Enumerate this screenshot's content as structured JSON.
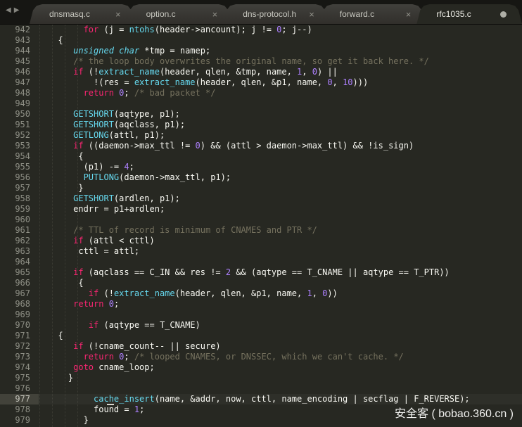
{
  "colors": {
    "background": "#272822",
    "tab_bar": "#161613",
    "tab_inactive_top": "#41403c",
    "tab_inactive_bottom": "#312f2b",
    "text": "#f8f8f2",
    "keyword": "#f92672",
    "function": "#66d9ef",
    "type": "#66d9ef",
    "number": "#ae81ff",
    "comment": "#75715e",
    "line_number": "#8f9086",
    "current_line_gutter": "#42423a"
  },
  "tab_bar": {
    "nav": {
      "back_label": "◀",
      "forward_label": "▶"
    },
    "tabs": [
      {
        "label": "dnsmasq.c",
        "close": "×",
        "active": false,
        "modified": false
      },
      {
        "label": "option.c",
        "close": "×",
        "active": false,
        "modified": false
      },
      {
        "label": "dns-protocol.h",
        "close": "×",
        "active": false,
        "modified": false
      },
      {
        "label": "forward.c",
        "close": "×",
        "active": false,
        "modified": false
      },
      {
        "label": "rfc1035.c",
        "close": "",
        "active": true,
        "modified": true
      }
    ]
  },
  "editor": {
    "language": "C",
    "current_line": 977,
    "lines": [
      {
        "n": 942,
        "indent": 7,
        "tokens": [
          [
            "k",
            "for"
          ],
          [
            "p",
            " (j = "
          ],
          [
            "f",
            "ntohs"
          ],
          [
            "p",
            "(header->ancount); j != "
          ],
          [
            "n",
            "0"
          ],
          [
            "p",
            "; j--)"
          ]
        ]
      },
      {
        "n": 943,
        "indent": 2,
        "tokens": [
          [
            "p",
            "{"
          ]
        ]
      },
      {
        "n": 944,
        "indent": 5,
        "tokens": [
          [
            "y",
            "unsigned"
          ],
          [
            "p",
            " "
          ],
          [
            "y",
            "char"
          ],
          [
            "p",
            " *tmp = namep;"
          ]
        ]
      },
      {
        "n": 945,
        "indent": 5,
        "tokens": [
          [
            "c",
            "/* the loop body overwrites the original name, so get it back here. */"
          ]
        ]
      },
      {
        "n": 946,
        "indent": 5,
        "tokens": [
          [
            "k",
            "if"
          ],
          [
            "p",
            " (!"
          ],
          [
            "f",
            "extract_name"
          ],
          [
            "p",
            "(header, qlen, &tmp, name, "
          ],
          [
            "n",
            "1"
          ],
          [
            "p",
            ", "
          ],
          [
            "n",
            "0"
          ],
          [
            "p",
            ") ||"
          ]
        ]
      },
      {
        "n": 947,
        "indent": 9,
        "tokens": [
          [
            "p",
            "!(res = "
          ],
          [
            "f",
            "extract_name"
          ],
          [
            "p",
            "(header, qlen, &p1, name, "
          ],
          [
            "n",
            "0"
          ],
          [
            "p",
            ", "
          ],
          [
            "n",
            "10"
          ],
          [
            "p",
            ")))"
          ]
        ]
      },
      {
        "n": 948,
        "indent": 7,
        "tokens": [
          [
            "k",
            "return"
          ],
          [
            "p",
            " "
          ],
          [
            "n",
            "0"
          ],
          [
            "p",
            "; "
          ],
          [
            "c",
            "/* bad packet */"
          ]
        ]
      },
      {
        "n": 949,
        "indent": 0,
        "tokens": []
      },
      {
        "n": 950,
        "indent": 5,
        "tokens": [
          [
            "f",
            "GETSHORT"
          ],
          [
            "p",
            "(aqtype, p1);"
          ]
        ]
      },
      {
        "n": 951,
        "indent": 5,
        "tokens": [
          [
            "f",
            "GETSHORT"
          ],
          [
            "p",
            "(aqclass, p1);"
          ]
        ]
      },
      {
        "n": 952,
        "indent": 5,
        "tokens": [
          [
            "f",
            "GETLONG"
          ],
          [
            "p",
            "(attl, p1);"
          ]
        ]
      },
      {
        "n": 953,
        "indent": 5,
        "tokens": [
          [
            "k",
            "if"
          ],
          [
            "p",
            " ((daemon->max_ttl != "
          ],
          [
            "n",
            "0"
          ],
          [
            "p",
            ") && (attl > daemon->max_ttl) && !is_sign)"
          ]
        ]
      },
      {
        "n": 954,
        "indent": 6,
        "tokens": [
          [
            "p",
            "{"
          ]
        ]
      },
      {
        "n": 955,
        "indent": 7,
        "tokens": [
          [
            "p",
            "(p1) -= "
          ],
          [
            "n",
            "4"
          ],
          [
            "p",
            ";"
          ]
        ]
      },
      {
        "n": 956,
        "indent": 7,
        "tokens": [
          [
            "f",
            "PUTLONG"
          ],
          [
            "p",
            "(daemon->max_ttl, p1);"
          ]
        ]
      },
      {
        "n": 957,
        "indent": 6,
        "tokens": [
          [
            "p",
            "}"
          ]
        ]
      },
      {
        "n": 958,
        "indent": 5,
        "tokens": [
          [
            "f",
            "GETSHORT"
          ],
          [
            "p",
            "(ardlen, p1);"
          ]
        ]
      },
      {
        "n": 959,
        "indent": 5,
        "tokens": [
          [
            "p",
            "endrr = p1+ardlen;"
          ]
        ]
      },
      {
        "n": 960,
        "indent": 0,
        "tokens": []
      },
      {
        "n": 961,
        "indent": 5,
        "tokens": [
          [
            "c",
            "/* TTL of record is minimum of CNAMES and PTR */"
          ]
        ]
      },
      {
        "n": 962,
        "indent": 5,
        "tokens": [
          [
            "k",
            "if"
          ],
          [
            "p",
            " (attl < cttl)"
          ]
        ]
      },
      {
        "n": 963,
        "indent": 6,
        "tokens": [
          [
            "p",
            "cttl = attl;"
          ]
        ]
      },
      {
        "n": 964,
        "indent": 0,
        "tokens": []
      },
      {
        "n": 965,
        "indent": 5,
        "tokens": [
          [
            "k",
            "if"
          ],
          [
            "p",
            " (aqclass == C_IN && res != "
          ],
          [
            "n",
            "2"
          ],
          [
            "p",
            " && (aqtype == T_CNAME || aqtype == T_PTR))"
          ]
        ]
      },
      {
        "n": 966,
        "indent": 6,
        "tokens": [
          [
            "p",
            "{"
          ]
        ]
      },
      {
        "n": 967,
        "indent": 8,
        "tokens": [
          [
            "k",
            "if"
          ],
          [
            "p",
            " (!"
          ],
          [
            "f",
            "extract_name"
          ],
          [
            "p",
            "(header, qlen, &p1, name, "
          ],
          [
            "n",
            "1"
          ],
          [
            "p",
            ", "
          ],
          [
            "n",
            "0"
          ],
          [
            "p",
            "))"
          ]
        ]
      },
      {
        "n": 968,
        "indent": 5,
        "tokens": [
          [
            "k",
            "return"
          ],
          [
            "p",
            " "
          ],
          [
            "n",
            "0"
          ],
          [
            "p",
            ";"
          ]
        ]
      },
      {
        "n": 969,
        "indent": 0,
        "tokens": []
      },
      {
        "n": 970,
        "indent": 8,
        "tokens": [
          [
            "k",
            "if"
          ],
          [
            "p",
            " (aqtype == T_CNAME)"
          ]
        ]
      },
      {
        "n": 971,
        "indent": 2,
        "tokens": [
          [
            "p",
            "{"
          ]
        ]
      },
      {
        "n": 972,
        "indent": 5,
        "tokens": [
          [
            "k",
            "if"
          ],
          [
            "p",
            " (!cname_count-- || secure)"
          ]
        ]
      },
      {
        "n": 973,
        "indent": 7,
        "tokens": [
          [
            "k",
            "return"
          ],
          [
            "p",
            " "
          ],
          [
            "n",
            "0"
          ],
          [
            "p",
            "; "
          ],
          [
            "c",
            "/* looped CNAMES, or DNSSEC, which we can't cache. */"
          ]
        ]
      },
      {
        "n": 974,
        "indent": 5,
        "tokens": [
          [
            "k",
            "goto"
          ],
          [
            "p",
            " cname_loop;"
          ]
        ]
      },
      {
        "n": 975,
        "indent": 4,
        "tokens": [
          [
            "p",
            "}"
          ]
        ]
      },
      {
        "n": 976,
        "indent": 0,
        "tokens": []
      },
      {
        "n": 977,
        "indent": 9,
        "tokens": [
          [
            "f",
            "cache_insert"
          ],
          [
            "p",
            "(name, &addr, now, cttl, name_encoding | secflag | F_REVERSE);"
          ]
        ]
      },
      {
        "n": 978,
        "indent": 9,
        "tokens": [
          [
            "p",
            "found = "
          ],
          [
            "n",
            "1"
          ],
          [
            "p",
            ";"
          ]
        ]
      },
      {
        "n": 979,
        "indent": 7,
        "tokens": [
          [
            "p",
            "}"
          ]
        ]
      }
    ]
  },
  "watermark": {
    "text": "安全客 ( bobao.360.cn )"
  }
}
